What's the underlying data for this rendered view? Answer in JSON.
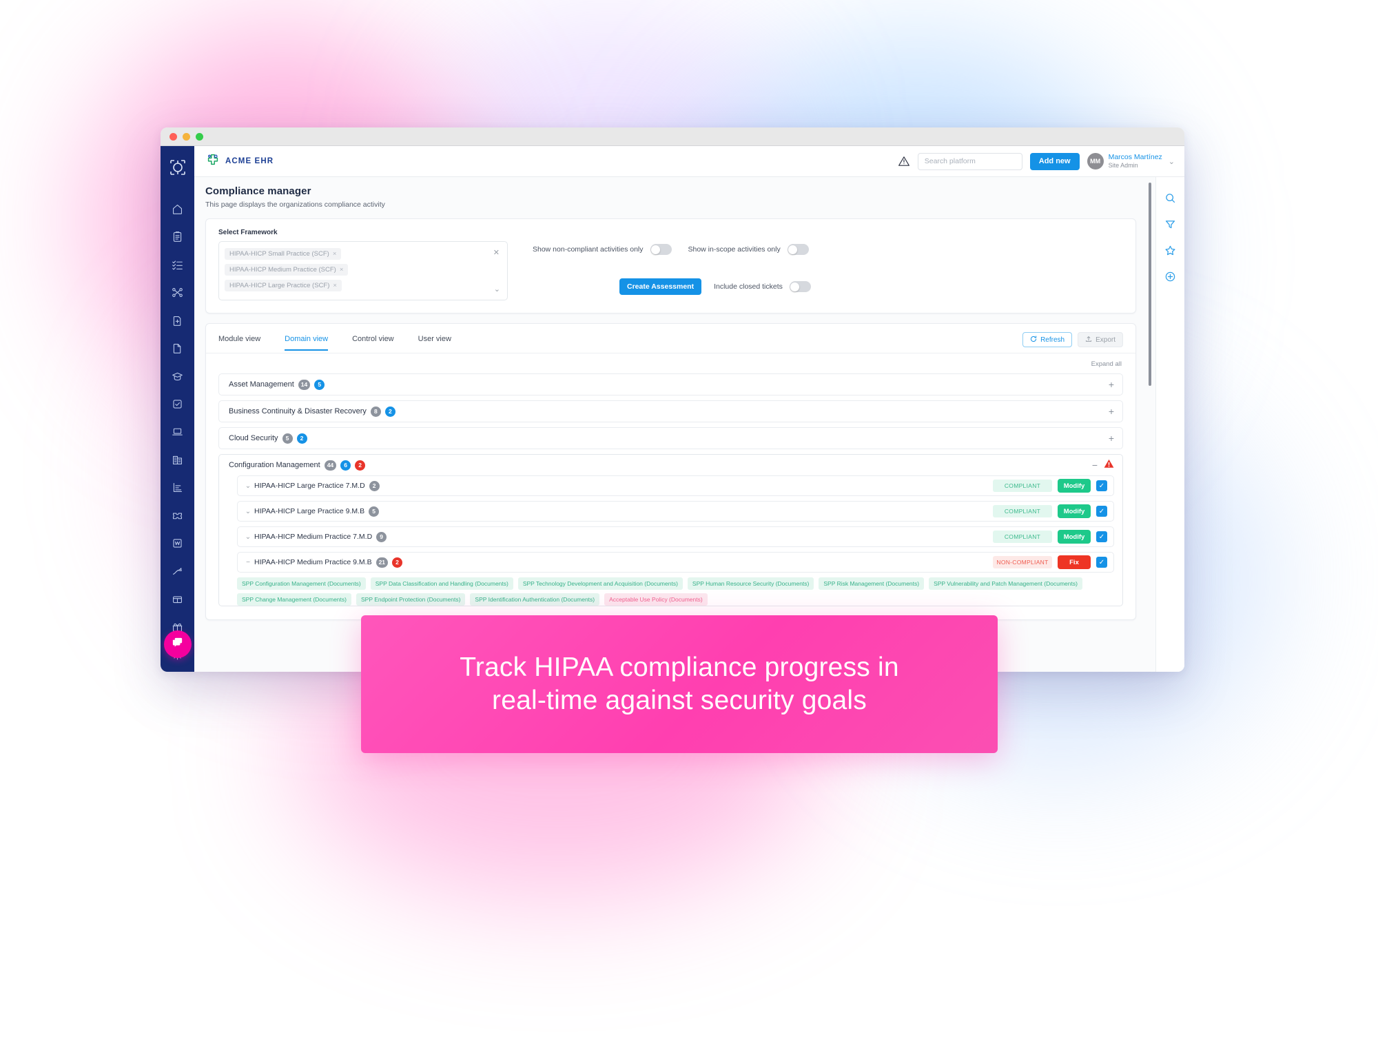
{
  "window": {
    "traffic_lights": [
      "close",
      "minimize",
      "maximize"
    ]
  },
  "topbar": {
    "logo_text": "ACME EHR",
    "warning_icon": "warning-triangle-icon",
    "search_placeholder": "Search platform",
    "search_value": "",
    "add_new_label": "Add new",
    "user": {
      "initials": "MM",
      "name": "Marcos Martínez",
      "role": "Site Admin",
      "caret": "⌄"
    }
  },
  "leftnav": {
    "brand_icon": "aperture-brand-icon",
    "items": [
      {
        "icon": "home-icon",
        "name": "home"
      },
      {
        "icon": "clipboard-icon",
        "name": "assessments"
      },
      {
        "icon": "checklist-icon",
        "name": "tasks"
      },
      {
        "icon": "share-nodes-icon",
        "name": "integrations"
      },
      {
        "icon": "file-plus-icon",
        "name": "new-document"
      },
      {
        "icon": "file-icon",
        "name": "documents"
      },
      {
        "icon": "graduation-cap-icon",
        "name": "training"
      },
      {
        "icon": "check-square-icon",
        "name": "approvals"
      },
      {
        "icon": "laptop-icon",
        "name": "devices"
      },
      {
        "icon": "building-icon",
        "name": "vendors"
      },
      {
        "icon": "bar-chart-icon",
        "name": "reports"
      },
      {
        "icon": "ticket-icon",
        "name": "tickets"
      },
      {
        "icon": "wiki-icon",
        "name": "wiki"
      },
      {
        "icon": "trending-up-icon",
        "name": "analytics"
      },
      {
        "icon": "store-icon",
        "name": "marketplace"
      },
      {
        "icon": "gift-icon",
        "name": "rewards"
      },
      {
        "icon": "gear-icon",
        "name": "settings"
      }
    ],
    "chat_icon": "chat-bubbles-icon"
  },
  "rightrail": {
    "items": [
      {
        "icon": "search-icon",
        "name": "search"
      },
      {
        "icon": "filter-icon",
        "name": "filter"
      },
      {
        "icon": "star-icon",
        "name": "favorites"
      },
      {
        "icon": "plus-circle-icon",
        "name": "add"
      }
    ]
  },
  "page": {
    "title": "Compliance manager",
    "subtitle": "This page displays the organizations compliance activity"
  },
  "filters": {
    "framework_label": "Select Framework",
    "chips": [
      "HIPAA-HICP Small Practice (SCF)",
      "HIPAA-HICP Medium Practice (SCF)",
      "HIPAA-HICP Large Practice (SCF)"
    ],
    "chip_remove": "×",
    "clear_all": "✕",
    "dropdown_caret": "⌄",
    "toggles": [
      {
        "label": "Show non-compliant activities only",
        "on": false
      },
      {
        "label": "Show in-scope activities only",
        "on": false
      }
    ],
    "create_assessment_label": "Create Assessment",
    "include_closed": {
      "label": "Include closed tickets",
      "on": false
    }
  },
  "table": {
    "tabs": [
      {
        "label": "Module view",
        "active": false
      },
      {
        "label": "Domain view",
        "active": true
      },
      {
        "label": "Control view",
        "active": false
      },
      {
        "label": "User view",
        "active": false
      }
    ],
    "refresh_label": "Refresh",
    "export_label": "Export",
    "expand_all_label": "Expand all",
    "domains": [
      {
        "name": "Asset Management",
        "badges": [
          {
            "value": "14",
            "color": "gray"
          },
          {
            "value": "5",
            "color": "blue"
          }
        ],
        "expanded": false,
        "toggle": "+",
        "alert": false
      },
      {
        "name": "Business Continuity & Disaster Recovery",
        "badges": [
          {
            "value": "8",
            "color": "gray"
          },
          {
            "value": "2",
            "color": "blue"
          }
        ],
        "expanded": false,
        "toggle": "+",
        "alert": false
      },
      {
        "name": "Cloud Security",
        "badges": [
          {
            "value": "5",
            "color": "gray"
          },
          {
            "value": "2",
            "color": "blue"
          }
        ],
        "expanded": false,
        "toggle": "+",
        "alert": false
      },
      {
        "name": "Configuration Management",
        "badges": [
          {
            "value": "44",
            "color": "gray"
          },
          {
            "value": "6",
            "color": "blue"
          },
          {
            "value": "2",
            "color": "red"
          }
        ],
        "expanded": true,
        "toggle": "−",
        "alert": true
      }
    ],
    "controls": [
      {
        "chevron": "⌄",
        "name": "HIPAA-HICP Large Practice 7.M.D",
        "badges": [
          {
            "value": "2",
            "color": "gray"
          }
        ],
        "status": "COMPLIANT",
        "status_type": "ok",
        "action": "Modify",
        "action_type": "modify",
        "checked": true
      },
      {
        "chevron": "⌄",
        "name": "HIPAA-HICP Large Practice 9.M.B",
        "badges": [
          {
            "value": "5",
            "color": "gray"
          }
        ],
        "status": "COMPLIANT",
        "status_type": "ok",
        "action": "Modify",
        "action_type": "modify",
        "checked": true
      },
      {
        "chevron": "⌄",
        "name": "HIPAA-HICP Medium Practice 7.M.D",
        "badges": [
          {
            "value": "9",
            "color": "gray"
          }
        ],
        "status": "COMPLIANT",
        "status_type": "ok",
        "action": "Modify",
        "action_type": "modify",
        "checked": true
      },
      {
        "chevron": "−",
        "name": "HIPAA-HICP Medium Practice 9.M.B",
        "badges": [
          {
            "value": "21",
            "color": "gray"
          },
          {
            "value": "2",
            "color": "red"
          }
        ],
        "status": "NON-COMPLIANT",
        "status_type": "bad",
        "action": "Fix",
        "action_type": "fix",
        "checked": true
      }
    ],
    "spp_tags": [
      {
        "label": "SPP Configuration Management (Documents)",
        "tone": "green"
      },
      {
        "label": "SPP Data Classification and Handling (Documents)",
        "tone": "green"
      },
      {
        "label": "SPP Technology Development and Acquisition (Documents)",
        "tone": "green"
      },
      {
        "label": "SPP Human Resource Security (Documents)",
        "tone": "green"
      },
      {
        "label": "SPP Risk Management (Documents)",
        "tone": "green"
      },
      {
        "label": "SPP Vulnerability and Patch Management (Documents)",
        "tone": "green"
      },
      {
        "label": "SPP Change Management (Documents)",
        "tone": "green"
      },
      {
        "label": "SPP Endpoint Protection (Documents)",
        "tone": "green"
      },
      {
        "label": "SPP Identification Authentication (Documents)",
        "tone": "green"
      },
      {
        "label": "Acceptable Use Policy (Documents)",
        "tone": "pink"
      }
    ]
  },
  "banner": {
    "line1": "Track HIPAA compliance progress in",
    "line2": "real-time against security goals",
    "color": "#ff3fb0"
  },
  "colors": {
    "accent_blue": "#1592e6",
    "nav_navy": "#162a73",
    "success_green": "#1ec98a",
    "danger_red": "#ee3524",
    "chat_pink": "#f5009e"
  }
}
